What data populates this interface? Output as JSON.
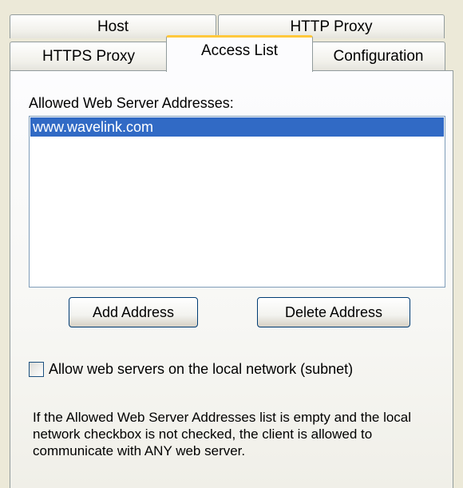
{
  "tabs": {
    "row1": [
      "Host",
      "HTTP Proxy"
    ],
    "row2": [
      "HTTPS Proxy",
      "Access List",
      "Configuration"
    ],
    "active": "Access List"
  },
  "access_list": {
    "list_label": "Allowed Web Server Addresses:",
    "addresses": [
      "www.wavelink.com"
    ],
    "selected_address": "www.wavelink.com",
    "add_button": "Add Address",
    "delete_button": "Delete Address",
    "local_network_checkbox": {
      "label": "Allow web servers on the local network (subnet)",
      "checked": false
    },
    "info_text": "If the Allowed Web Server Addresses list is empty and the local network checkbox is not checked, the client is allowed to communicate with ANY web server."
  },
  "colors": {
    "selection": "#316ac5",
    "active_tab_accent": "#ffc83c",
    "button_border": "#003c74"
  }
}
